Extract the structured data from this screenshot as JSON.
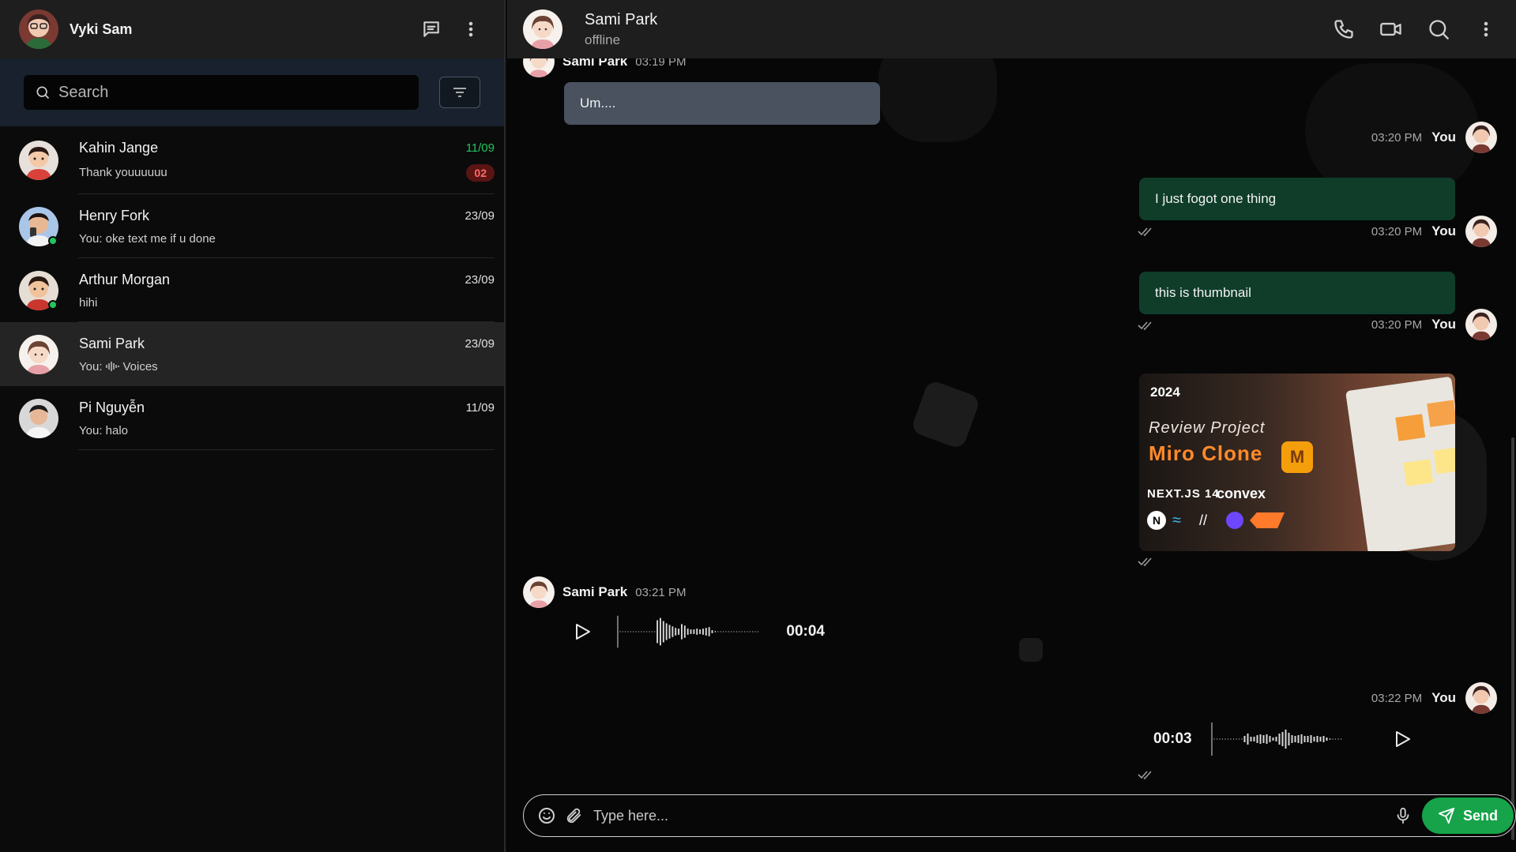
{
  "user": {
    "name": "Vyki Sam",
    "avatar": "user-avatar"
  },
  "sidebar": {
    "search_placeholder": "Search",
    "conversations": [
      {
        "name": "Kahin Jange",
        "date": "11/09",
        "preview": "Thank youuuuuu",
        "unread": "02",
        "online": false,
        "date_highlight": true
      },
      {
        "name": "Henry Fork",
        "date": "23/09",
        "preview": "You: oke text me if u done",
        "online": true
      },
      {
        "name": "Arthur Morgan",
        "date": "23/09",
        "preview": "hihi",
        "online": true
      },
      {
        "name": "Sami Park",
        "date": "23/09",
        "preview_prefix": "You:",
        "preview": "Voices",
        "active": true
      },
      {
        "name": "Pi Nguyễn",
        "date": "11/09",
        "preview": "You: halo"
      }
    ]
  },
  "chat": {
    "contact_name": "Sami Park",
    "contact_status": "offline",
    "messages": {
      "m0": {
        "sender": "Sami Park",
        "time": "03:19 PM",
        "text": "Um...."
      },
      "m1": {
        "sender": "You",
        "time": "03:20 PM",
        "text": "I just fogot one thing"
      },
      "m2": {
        "sender": "You",
        "time": "03:20 PM",
        "text": "this is thumbnail"
      },
      "m3": {
        "sender": "You",
        "time": "03:20 PM",
        "thumb_year": "2024",
        "thumb_title1": "Review Project",
        "thumb_title2": "Miro Clone",
        "thumb_next": "NEXT.JS 14",
        "thumb_convex": "convex"
      },
      "m4": {
        "sender": "Sami Park",
        "time": "03:21 PM",
        "duration": "00:04"
      },
      "m5": {
        "sender": "You",
        "time": "03:22 PM",
        "duration": "00:03"
      }
    },
    "composer": {
      "placeholder": "Type here...",
      "send_label": "Send"
    }
  },
  "colors": {
    "accent": "#16a34a",
    "outgoing_bubble": "#0f3d2a",
    "incoming_bubble": "#4a5260",
    "unread_badge": "#5b1414",
    "online": "#22c55e"
  }
}
